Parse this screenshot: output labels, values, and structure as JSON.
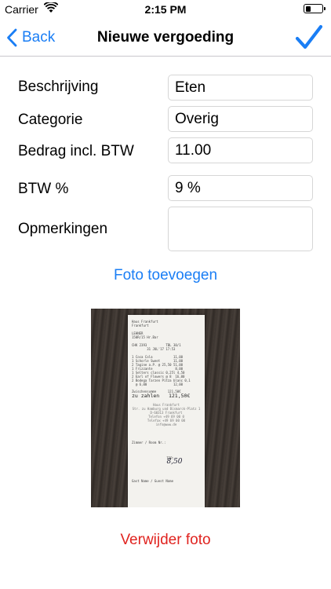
{
  "status_bar": {
    "carrier": "Carrier",
    "time": "2:15 PM",
    "battery_level": 0.35
  },
  "nav": {
    "back_label": "Back",
    "title": "Nieuwe vergoeding",
    "accent_color": "#1a7ef5"
  },
  "form": {
    "fields": [
      {
        "label": "Beschrijving",
        "value": "Eten"
      },
      {
        "label": "Categorie",
        "value": "Overig"
      },
      {
        "label": "Bedrag incl. BTW",
        "value": "11.00"
      },
      {
        "label": "BTW %",
        "value": "9 %"
      },
      {
        "label": "Opmerkingen",
        "value": ""
      }
    ]
  },
  "photo": {
    "add_label": "Foto toevoegen",
    "delete_label": "Verwijder foto",
    "delete_color": "#e0231f",
    "receipt": {
      "lines": [
        "Haus Frankfurt",
        "Frankfurt",
        "",
        "LEHNER",
        "150R/15 Hr.Bar",
        "",
        "CHK 2393          TBL 30/1",
        "        31 JUL'17 17:53",
        "",
        "1 Coca Cola           11,00",
        "1 Schorle Sweet       11,00",
        "2 Tagine a.P. @ 25,50 51,00",
        "1 Frizzante            8,00",
        "1 Selters classic 0,25l 4,50",
        "2 Earl of Flowers @ 8  16,00",
        "2 Bodega Tarzen Pitza blanc 0,1",
        "  @ 6,00              12,00"
      ],
      "subtotal": "Zwischensumme      121,50€",
      "total": "zu zahlen   121,50€",
      "footer_lines": [
        "Haus Frankfurt",
        "Str. zu Hamburg und Bismarck-Platz 1",
        "D-60313 Frankfurt",
        "Telefon +49 69 00 0",
        "Telefax +49 69 00 00",
        "info@www.de"
      ],
      "room_label": "Zimmer / Room Nr.:",
      "tip_label": "TIP:",
      "tip_value": "8,50",
      "guest_label": "Gast Name / Guest Name"
    }
  }
}
